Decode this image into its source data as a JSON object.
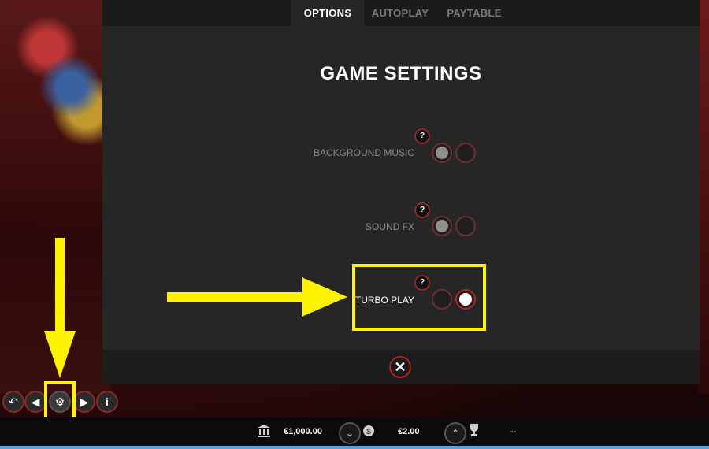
{
  "tabs": [
    {
      "label": "OPTIONS",
      "active": true
    },
    {
      "label": "AUTOPLAY",
      "active": false
    },
    {
      "label": "PAYTABLE",
      "active": false
    }
  ],
  "title": "GAME SETTINGS",
  "settings": [
    {
      "label": "BACKGROUND MUSIC",
      "help": "?",
      "on": true
    },
    {
      "label": "SOUND FX",
      "help": "?",
      "on": true
    },
    {
      "label": "TURBO PLAY",
      "help": "?",
      "on": false
    }
  ],
  "close_glyph": "✕",
  "controls": {
    "back_icon": "↶",
    "sound_icon": "◀",
    "settings_icon": "⚙",
    "forward_icon": "▶",
    "info_icon": "i"
  },
  "status": {
    "balance": "€1,000.00",
    "bet": "€2.00",
    "win": "--",
    "bank_icon": "bank-icon",
    "coins_icon": "coins-icon",
    "trophy_icon": "trophy-icon"
  },
  "colors": {
    "highlight": "#fff200",
    "accent_red": "#b32222",
    "overlay_bg": "#262626"
  }
}
